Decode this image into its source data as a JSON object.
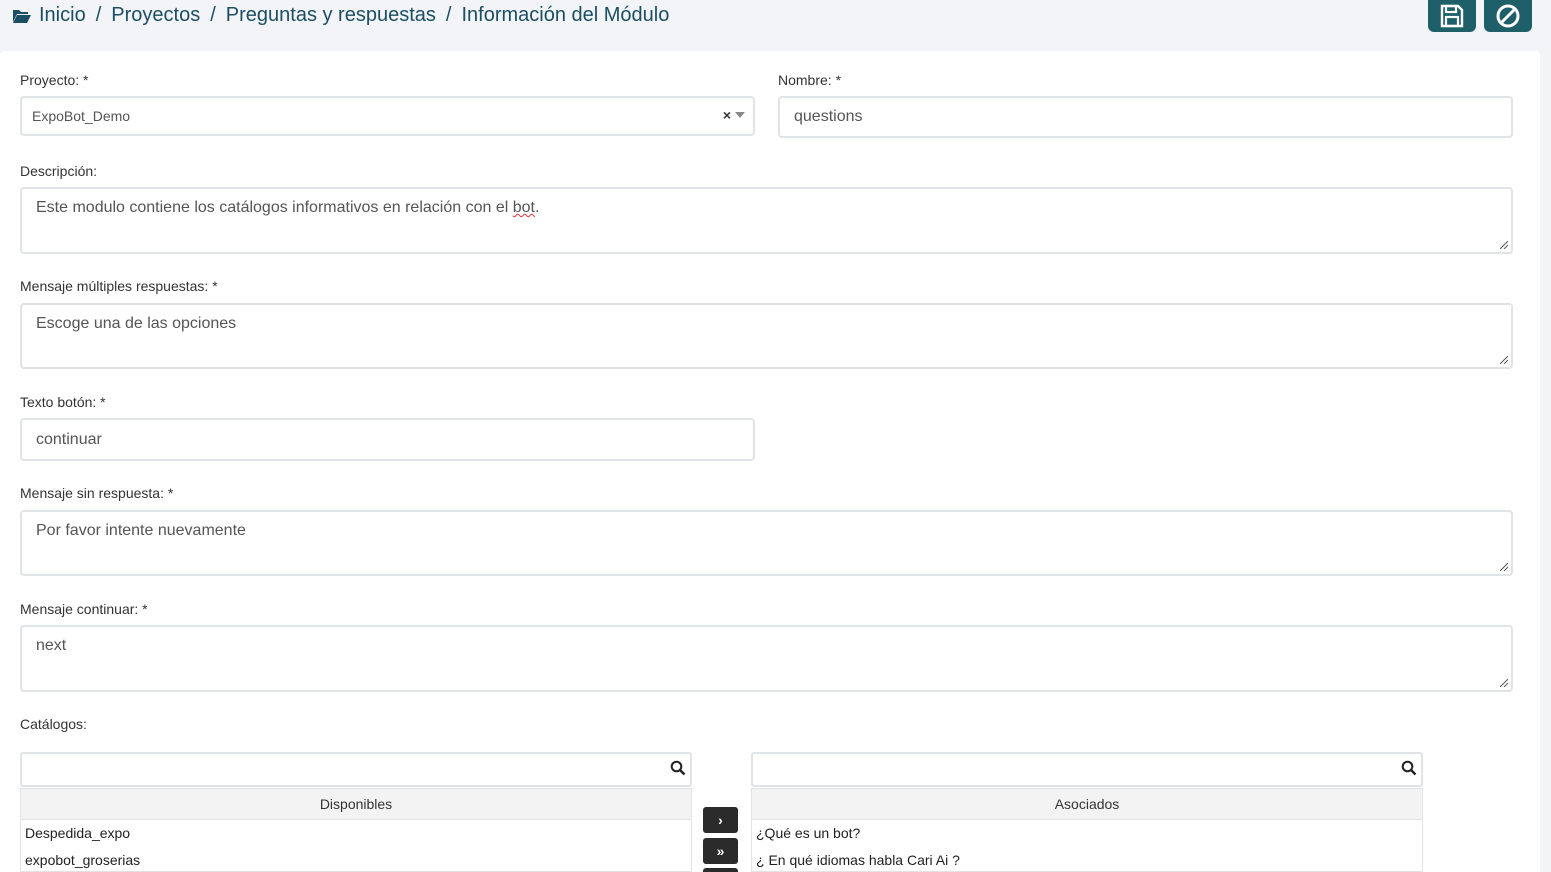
{
  "breadcrumb": {
    "items": [
      "Inicio",
      "Proyectos",
      "Preguntas y respuestas",
      "Información del Módulo"
    ],
    "separator": "/"
  },
  "toolbar": {
    "save_icon": "floppy-disk-icon",
    "cancel_icon": "ban-icon",
    "button_color": "#1f5f6a"
  },
  "form": {
    "proyecto": {
      "label": "Proyecto: *",
      "value": "ExpoBot_Demo"
    },
    "nombre": {
      "label": "Nombre: *",
      "value": "questions"
    },
    "descripcion": {
      "label": "Descripción:",
      "value_before": "Este modulo contiene los catálogos informativos en relación con el ",
      "value_flagged": "bot",
      "value_after": "."
    },
    "mensaje_multiples": {
      "label": "Mensaje múltiples respuestas: *",
      "value": "Escoge una de las opciones"
    },
    "texto_boton": {
      "label": "Texto botón: *",
      "value": "continuar"
    },
    "mensaje_sin_respuesta": {
      "label": "Mensaje sin respuesta: *",
      "value": "Por favor intente nuevamente"
    },
    "mensaje_continuar": {
      "label": "Mensaje continuar: *",
      "value": "next"
    }
  },
  "catalogos": {
    "label": "Catálogos:",
    "disponibles": {
      "header": "Disponibles",
      "items": [
        "Despedida_expo",
        "expobot_groserias"
      ]
    },
    "asociados": {
      "header": "Asociados",
      "items": [
        "¿Qué es un bot?",
        "¿ En qué idiomas habla Cari Ai ?"
      ]
    },
    "move_one_glyph": "›",
    "move_all_glyph": "»"
  }
}
